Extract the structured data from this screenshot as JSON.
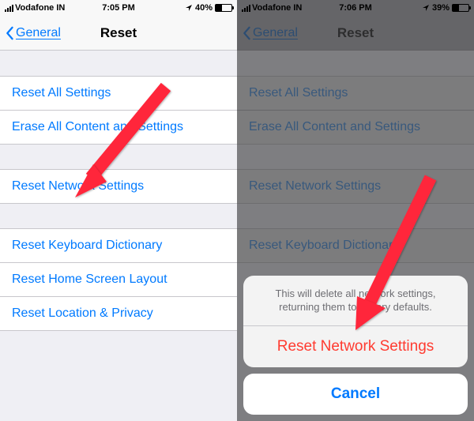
{
  "left": {
    "status": {
      "carrier": "Vodafone IN",
      "time": "7:05 PM",
      "battery": "40%"
    },
    "nav": {
      "back": "General",
      "title": "Reset"
    },
    "group1": [
      "Reset All Settings",
      "Erase All Content and Settings"
    ],
    "group2": [
      "Reset Network Settings"
    ],
    "group3": [
      "Reset Keyboard Dictionary",
      "Reset Home Screen Layout",
      "Reset Location & Privacy"
    ]
  },
  "right": {
    "status": {
      "carrier": "Vodafone IN",
      "time": "7:06 PM",
      "battery": "39%"
    },
    "nav": {
      "back": "General",
      "title": "Reset"
    },
    "group1": [
      "Reset All Settings",
      "Erase All Content and Settings"
    ],
    "group2": [
      "Reset Network Settings"
    ],
    "group3": [
      "Reset Keyboard Dictionary"
    ],
    "sheet": {
      "message": "This will delete all network settings, returning them to factory defaults.",
      "action": "Reset Network Settings",
      "cancel": "Cancel"
    }
  }
}
